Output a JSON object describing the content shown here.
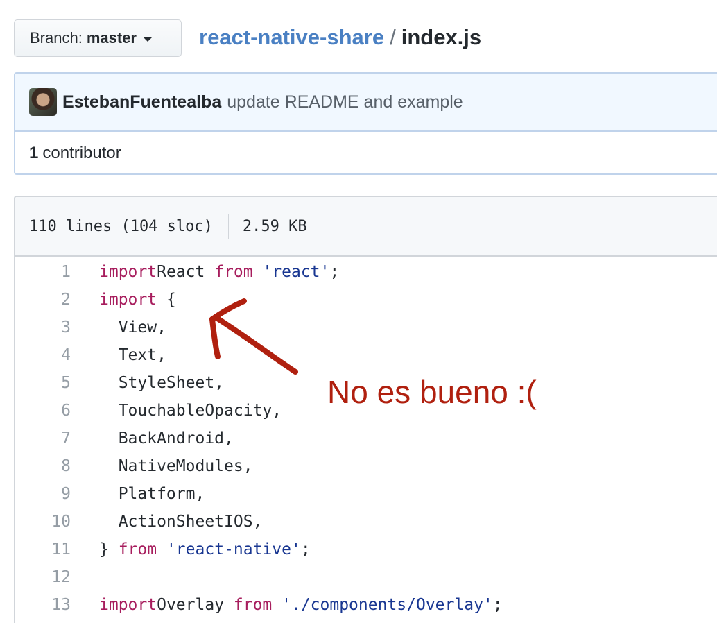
{
  "branch": {
    "prefix": "Branch:",
    "name": "master"
  },
  "breadcrumb": {
    "repo": "react-native-share",
    "separator": "/",
    "file": "index.js"
  },
  "commit": {
    "avatar_alt": "EstebanFuentealba",
    "author": "EstebanFuentealba",
    "message": "update README and example"
  },
  "contributors": {
    "count": "1",
    "label": "contributor"
  },
  "file_info": {
    "lines": "110 lines (104 sloc)",
    "size": "2.59 KB"
  },
  "code_lines": [
    {
      "num": "1",
      "tokens": [
        [
          "kw",
          "import"
        ],
        [
          "",
          "React "
        ],
        [
          "kw",
          "from"
        ],
        [
          "",
          " "
        ],
        [
          "str",
          "'react'"
        ],
        [
          "",
          ";"
        ]
      ]
    },
    {
      "num": "2",
      "tokens": [
        [
          "kw",
          "import"
        ],
        [
          "",
          " {"
        ]
      ]
    },
    {
      "num": "3",
      "tokens": [
        [
          "",
          "  View,"
        ]
      ]
    },
    {
      "num": "4",
      "tokens": [
        [
          "",
          "  Text,"
        ]
      ]
    },
    {
      "num": "5",
      "tokens": [
        [
          "",
          "  StyleSheet,"
        ]
      ]
    },
    {
      "num": "6",
      "tokens": [
        [
          "",
          "  TouchableOpacity,"
        ]
      ]
    },
    {
      "num": "7",
      "tokens": [
        [
          "",
          "  BackAndroid,"
        ]
      ]
    },
    {
      "num": "8",
      "tokens": [
        [
          "",
          "  NativeModules,"
        ]
      ]
    },
    {
      "num": "9",
      "tokens": [
        [
          "",
          "  Platform,"
        ]
      ]
    },
    {
      "num": "10",
      "tokens": [
        [
          "",
          "  ActionSheetIOS,"
        ]
      ]
    },
    {
      "num": "11",
      "tokens": [
        [
          "",
          "} "
        ],
        [
          "kw",
          "from"
        ],
        [
          "",
          " "
        ],
        [
          "str",
          "'react-native'"
        ],
        [
          "",
          ";"
        ]
      ]
    },
    {
      "num": "12",
      "tokens": []
    },
    {
      "num": "13",
      "tokens": [
        [
          "kw",
          "import"
        ],
        [
          "",
          "Overlay "
        ],
        [
          "kw",
          "from"
        ],
        [
          "",
          " "
        ],
        [
          "str",
          "'./components/Overlay'"
        ],
        [
          "",
          ";"
        ]
      ]
    }
  ],
  "annotation": {
    "text": "No es bueno :(",
    "color": "#b0200f"
  },
  "colors": {
    "link": "#4a80c3",
    "keyword": "#a71d5d",
    "string": "#183691",
    "line_number": "#959da5"
  }
}
